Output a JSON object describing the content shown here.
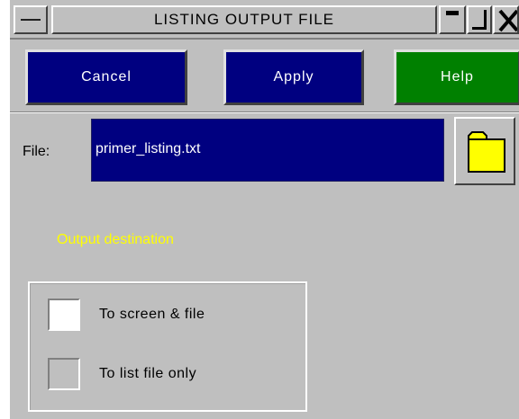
{
  "window": {
    "title": "LISTING OUTPUT FILE"
  },
  "actions": {
    "cancel_label": "Cancel",
    "apply_label": "Apply",
    "help_label": "Help"
  },
  "file": {
    "label": "File:",
    "value": "primer_listing.txt"
  },
  "output_destination": {
    "heading": "Output destination",
    "options": [
      {
        "label": "To screen & file",
        "checked": true
      },
      {
        "label": "To list file only",
        "checked": false
      }
    ]
  },
  "colors": {
    "action_button": "#000080",
    "help_button": "#008000",
    "file_field": "#000080",
    "heading_text": "#ffff00",
    "panel": "#bfbfbf",
    "folder_icon": "#ffff00"
  },
  "icons": [
    "system-menu-icon",
    "minimize-icon",
    "maximize-icon",
    "close-icon",
    "folder-icon"
  ]
}
